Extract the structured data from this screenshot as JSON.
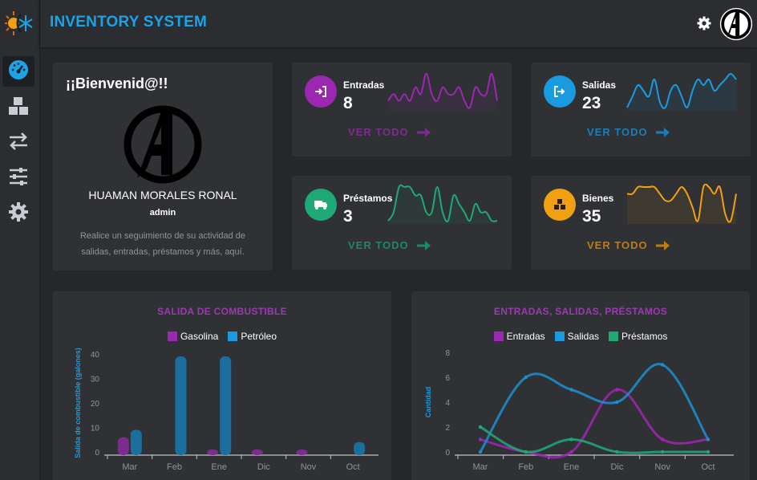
{
  "header": {
    "title": "INVENTORY SYSTEM"
  },
  "welcome": {
    "title": "¡¡Bienvenid@!!",
    "name": "HUAMAN MORALES RONAL",
    "role": "admin",
    "description": "Realice un seguimiento de su actividad de salidas, entradas, préstamos y más, aquí."
  },
  "stats": [
    {
      "label": "Entradas",
      "value": "8",
      "link": "VER TODO",
      "color": "#9c27b0",
      "icon": "sign-in-icon",
      "spark": [
        2,
        3,
        2,
        3,
        2,
        4,
        3,
        6,
        3,
        2,
        4,
        3,
        3,
        4,
        2,
        1,
        4,
        3,
        3,
        6,
        2
      ]
    },
    {
      "label": "Salidas",
      "value": "23",
      "link": "VER TODO",
      "color": "#1a9be0",
      "icon": "sign-out-icon",
      "spark": [
        1,
        3,
        5,
        4,
        3,
        6,
        2,
        1,
        4,
        5,
        3,
        1,
        4,
        6,
        5,
        6,
        4,
        5,
        6,
        7,
        6
      ]
    },
    {
      "label": "Préstamos",
      "value": "3",
      "link": "VER TODO",
      "color": "#1faa75",
      "icon": "truck-icon",
      "spark": [
        2,
        3,
        6,
        6,
        6,
        5,
        5,
        3,
        3,
        6,
        3,
        2,
        5,
        4,
        3,
        2,
        4,
        3,
        3,
        2,
        2
      ]
    },
    {
      "label": "Bienes",
      "value": "35",
      "link": "VER TODO",
      "color": "#f0a010",
      "icon": "boxes-icon",
      "spark": [
        5,
        5,
        6,
        6,
        6,
        6,
        5,
        4,
        4,
        5,
        6,
        5,
        3,
        1,
        6,
        6,
        5,
        6,
        2,
        1,
        5
      ]
    }
  ],
  "chart_data": [
    {
      "type": "bar",
      "title": "SALIDA DE COMBUSTIBLE",
      "ylabel": "Salida de combustible (galones)",
      "xlabel": "",
      "categories": [
        "Mar",
        "Feb",
        "Ene",
        "Dic",
        "Nov",
        "Oct"
      ],
      "ylim": [
        0,
        40
      ],
      "yticks": [
        0,
        10,
        20,
        30,
        40
      ],
      "series": [
        {
          "name": "Gasolina",
          "color": "#7b2d8e",
          "values": [
            6,
            0,
            1,
            1,
            1,
            0
          ]
        },
        {
          "name": "Petróleo",
          "color": "#1b6e9e",
          "values": [
            9,
            39,
            39,
            0,
            0,
            4
          ]
        }
      ]
    },
    {
      "type": "line",
      "title": "ENTRADAS, SALIDAS, PRÉSTAMOS",
      "ylabel": "Cantidad",
      "xlabel": "",
      "categories": [
        "Mar",
        "Feb",
        "Ene",
        "Dic",
        "Nov",
        "Oct"
      ],
      "ylim": [
        0,
        8
      ],
      "yticks": [
        0,
        2,
        4,
        6,
        8
      ],
      "series": [
        {
          "name": "Entradas",
          "color": "#9c27b0",
          "values": [
            1,
            0,
            0,
            5,
            1,
            1
          ]
        },
        {
          "name": "Salidas",
          "color": "#1b8fd0",
          "values": [
            0,
            6,
            5,
            4,
            7,
            1
          ]
        },
        {
          "name": "Préstamos",
          "color": "#1faa75",
          "values": [
            2,
            0,
            1,
            0,
            0,
            0
          ]
        }
      ]
    }
  ]
}
